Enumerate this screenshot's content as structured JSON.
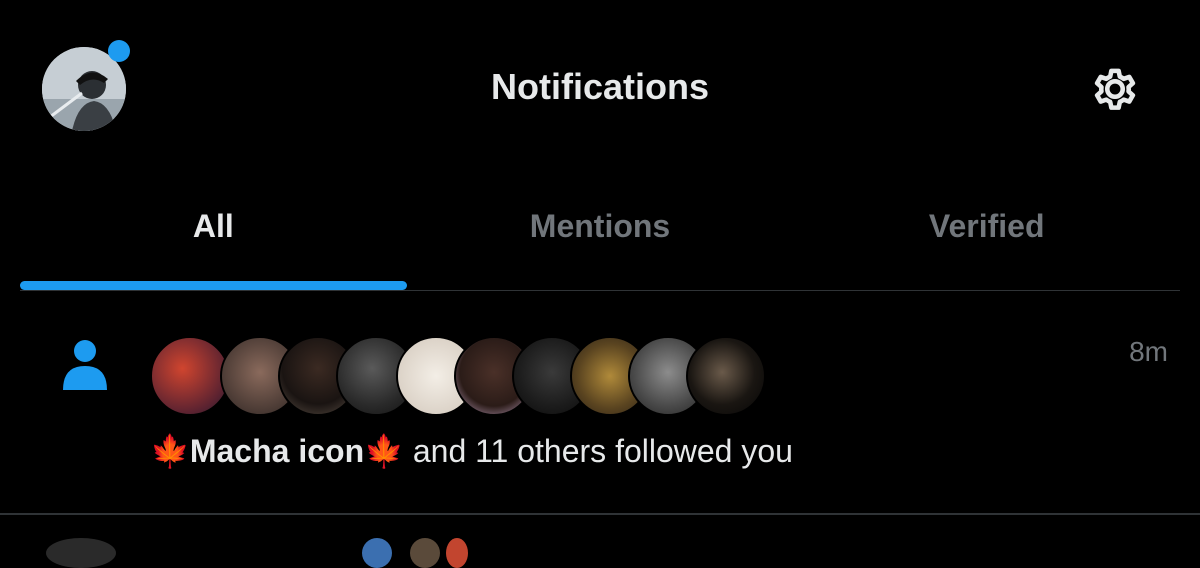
{
  "header": {
    "title": "Notifications",
    "unread_badge_color": "#1d9bf0",
    "settings_icon": "gear-icon"
  },
  "tabs": [
    {
      "label": "All",
      "active": true
    },
    {
      "label": "Mentions",
      "active": false
    },
    {
      "label": "Verified",
      "active": false
    }
  ],
  "colors": {
    "accent": "#1d9bf0",
    "background": "#000000",
    "text_primary": "#e7e9ea",
    "text_secondary": "#71767b",
    "divider": "#2f3336"
  },
  "notification": {
    "type_icon": "person-icon",
    "time": "8m",
    "leaf_emoji": "🍁",
    "name": "Macha icon",
    "message": " and 11 others followed you",
    "avatars_count": 11
  }
}
